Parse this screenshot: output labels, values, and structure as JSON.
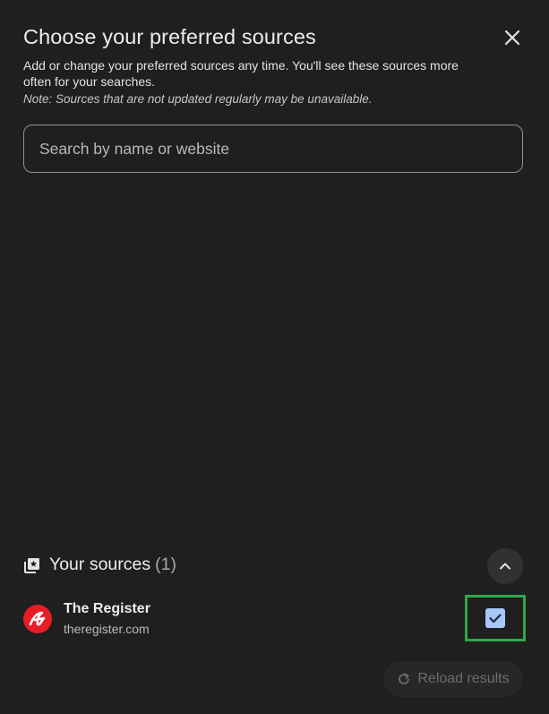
{
  "dialog": {
    "title": "Choose your preferred sources",
    "description": "Add or change your preferred sources any time. You'll see these sources more often for your searches.",
    "note": "Note: Sources that are not updated regularly may be unavailable.",
    "close_icon": "close-icon"
  },
  "search": {
    "placeholder": "Search by name or website",
    "value": ""
  },
  "your_sources": {
    "title": "Your sources",
    "count": "(1)",
    "icon": "sources-icon",
    "collapse_icon": "chevron-up-icon",
    "items": [
      {
        "name": "The Register",
        "url": "theregister.com",
        "checked": true
      }
    ]
  },
  "footer": {
    "reload_label": "Reload results",
    "reload_icon": "refresh-icon"
  },
  "colors": {
    "background": "#1f1f1f",
    "checkbox": "#a8c7fa",
    "highlight": "#2fa84a",
    "logo": "#e81c24"
  }
}
